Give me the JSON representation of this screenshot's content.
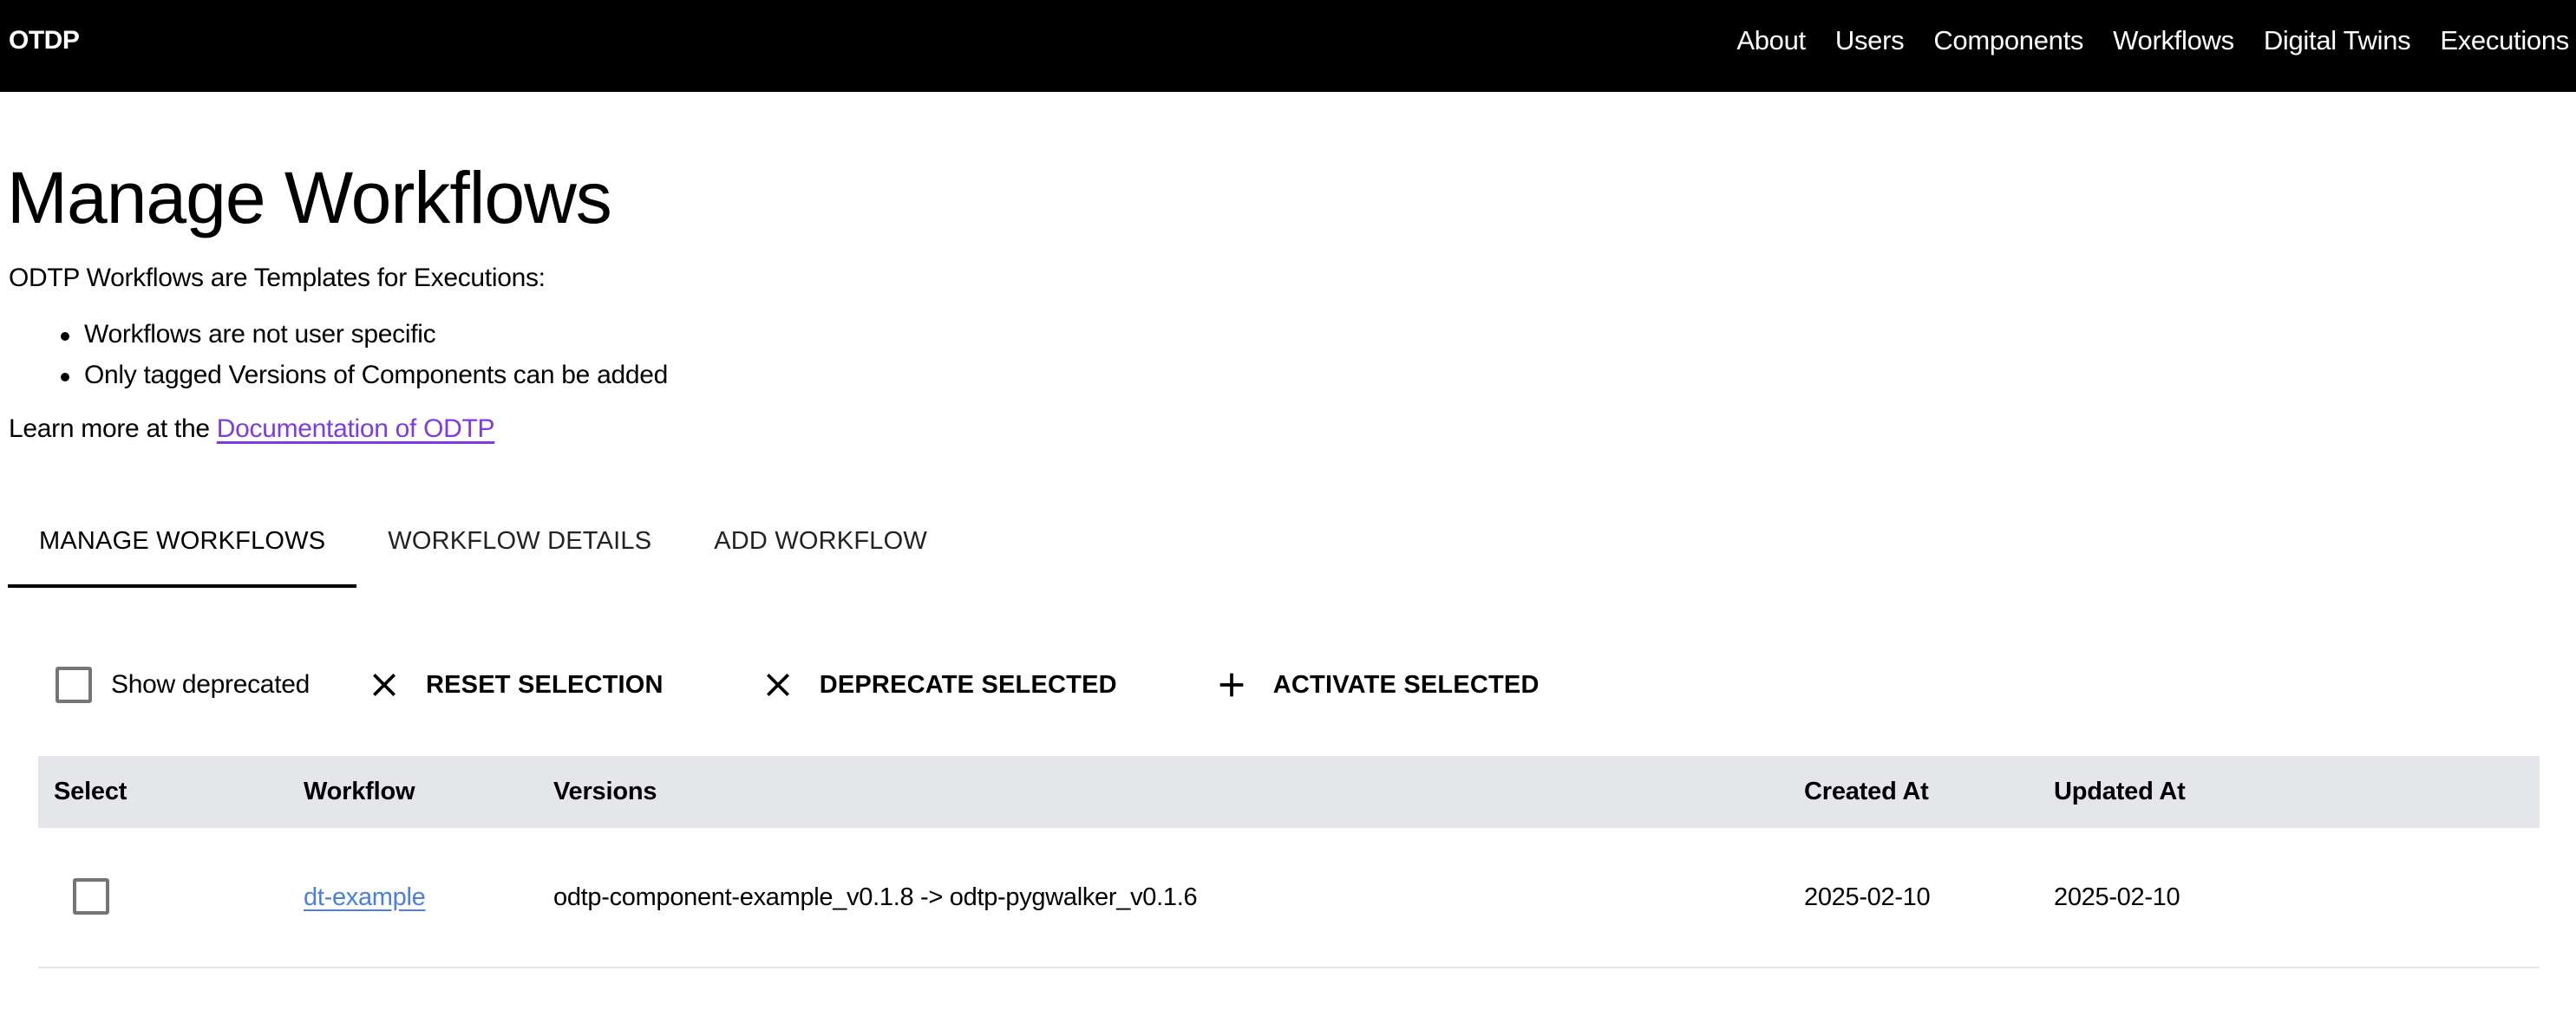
{
  "nav": {
    "brand": "OTDP",
    "links": [
      "About",
      "Users",
      "Components",
      "Workflows",
      "Digital Twins",
      "Executions"
    ]
  },
  "page": {
    "title": "Manage Workflows",
    "intro": "ODTP Workflows are Templates for Executions:",
    "bullets": [
      "Workflows are not user specific",
      "Only tagged Versions of Components can be added"
    ],
    "learn_prefix": "Learn more at the ",
    "learn_link": "Documentation of ODTP"
  },
  "tabs": [
    {
      "label": "MANAGE WORKFLOWS",
      "active": true
    },
    {
      "label": "WORKFLOW DETAILS",
      "active": false
    },
    {
      "label": "ADD WORKFLOW",
      "active": false
    }
  ],
  "toolbar": {
    "show_deprecated_label": "Show deprecated",
    "show_deprecated_checked": false,
    "reset_label": "RESET SELECTION",
    "deprecate_label": "DEPRECATE SELECTED",
    "activate_label": "ACTIVATE SELECTED"
  },
  "table": {
    "columns": [
      "Select",
      "Workflow",
      "Versions",
      "Created At",
      "Updated At"
    ],
    "rows": [
      {
        "selected": false,
        "workflow": "dt-example",
        "versions": "odtp-component-example_v0.1.8 -> odtp-pygwalker_v0.1.6",
        "created_at": "2025-02-10",
        "updated_at": "2025-02-10"
      }
    ]
  },
  "colors": {
    "nav_bg": "#000000",
    "visited_link": "#7e3ae4",
    "link": "#4a7fe0",
    "table_header_bg": "#e5e6ea"
  }
}
